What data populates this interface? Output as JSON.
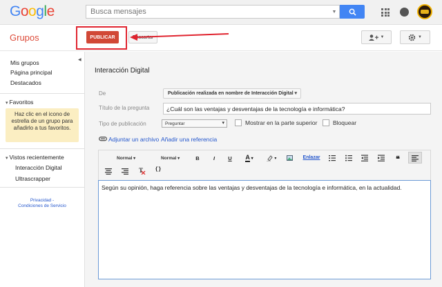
{
  "header": {
    "logo_letters": [
      "G",
      "o",
      "o",
      "g",
      "l",
      "e"
    ],
    "logo_colors": [
      "#4285f4",
      "#ea4335",
      "#fbbc05",
      "#4285f4",
      "#34a853",
      "#ea4335"
    ],
    "search_placeholder": "Busca mensajes"
  },
  "subheader": {
    "app_name": "Grupos",
    "publish_label": "PUBLICAR",
    "discard_label": "Descartar",
    "accent_color": "#d14836",
    "highlight_color": "#e0242f"
  },
  "sidebar": {
    "links": [
      "Mis grupos",
      "Página principal",
      "Destacados"
    ],
    "favorites_title": "Favoritos",
    "favorites_tip": "Haz clic en el icono de estrella de un grupo para añadirlo a tus favoritos.",
    "recent_title": "Vistos recientemente",
    "recent_items": [
      "Interacción Digital",
      "Ultrascrapper"
    ],
    "privacy": "Privacidad -",
    "terms": "Condiciones de Servicio"
  },
  "compose": {
    "group_title": "Interacción Digital",
    "from_label": "De",
    "from_value": "Publicación realizada en nombre de Interacción Digital",
    "question_label": "Título de la pregunta",
    "question_value": "¿Cuál son las ventajas y desventajas de la tecnología e informática?",
    "type_label": "Tipo de publicación",
    "type_value": "Preguntar",
    "show_top_label": "Mostrar en la parte superior",
    "lock_label": "Bloquear",
    "attach_label": "Adjuntar un archivo",
    "reference_label": "Añadir una referencia",
    "body": "Según su opinión, haga referencia sobre las ventajas y desventajas de la tecnología e informática, en la actualidad."
  },
  "toolbar": {
    "font_family": "Normal",
    "font_size": "Normal",
    "bold": "B",
    "italic": "I",
    "underline": "U",
    "text_color": "A",
    "link": "Enlazar",
    "code": "{}"
  }
}
